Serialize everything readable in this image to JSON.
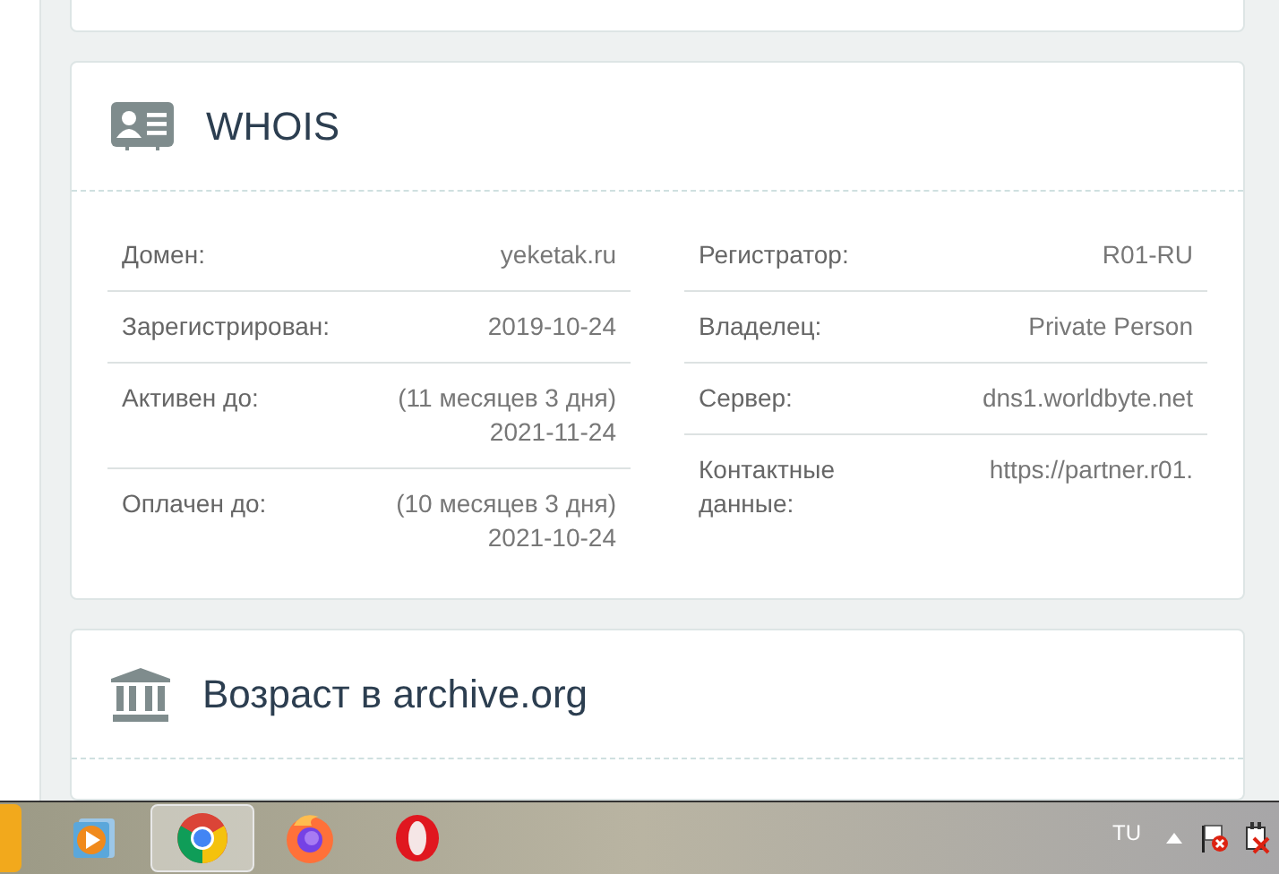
{
  "whois": {
    "title": "WHOIS",
    "left": [
      {
        "label": "Домен:",
        "value": [
          "yeketak.ru"
        ]
      },
      {
        "label": "Зарегистрирован:",
        "value": [
          "2019-10-24"
        ]
      },
      {
        "label": "Активен до:",
        "value": [
          "(11 месяцев 3 дня)",
          "2021-11-24"
        ]
      },
      {
        "label": "Оплачен до:",
        "value": [
          "(10 месяцев 3 дня)",
          "2021-10-24"
        ]
      }
    ],
    "right": [
      {
        "label": "Регистратор:",
        "value": [
          "R01-RU"
        ]
      },
      {
        "label": "Владелец:",
        "value": [
          "Private Person"
        ]
      },
      {
        "label": "Сервер:",
        "value": [
          "dns1.worldbyte.net"
        ]
      },
      {
        "label": "Контактные данные:",
        "value": [
          "https://partner.r01."
        ]
      }
    ]
  },
  "archive": {
    "title": "Возраст в archive.org"
  },
  "taskbar": {
    "apps": [
      {
        "kind": "media",
        "selected": false
      },
      {
        "kind": "chrome",
        "selected": true
      },
      {
        "kind": "firefox",
        "selected": false
      },
      {
        "kind": "opera",
        "selected": false
      }
    ],
    "language": "TU"
  }
}
